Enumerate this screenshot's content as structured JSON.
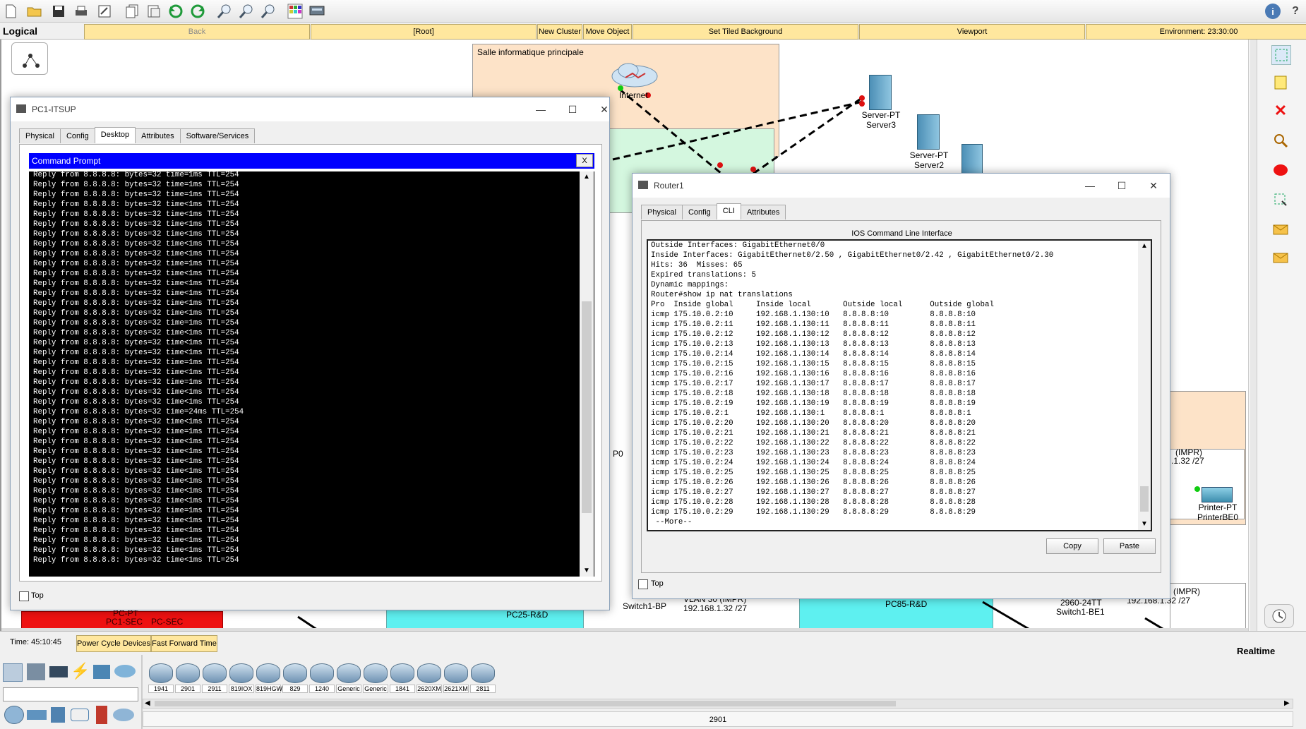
{
  "toolbar": {
    "icons": [
      "new-icon",
      "open-icon",
      "save-icon",
      "print-icon",
      "activity-wizard-icon",
      "copy-icon",
      "paste-icon",
      "undo-icon",
      "redo-icon",
      "zoom-in-icon",
      "zoom-reset-icon",
      "zoom-out-icon",
      "palette-icon",
      "custom-device-icon"
    ],
    "help_icon": "i"
  },
  "navbar": {
    "mode": "Logical",
    "back": "Back",
    "root": "[Root]",
    "new_cluster": "New Cluster",
    "move_object": "Move Object",
    "set_tiled_background": "Set Tiled Background",
    "viewport": "Viewport",
    "environment": "Environment: 23:30:00"
  },
  "workspace": {
    "cluster_label": "Salle informatique principale",
    "nodes": {
      "internet": "Internet",
      "server3_type": "Server-PT",
      "server3_name": "Server3",
      "server2_type": "Server-PT",
      "server2_name": "Server2",
      "printer_type": "Printer-PT",
      "printer_name": "PrinterBE0",
      "impr1": "(IMPR)",
      "impr1_ip": ".1.32 /27",
      "impr2": "(IMPR)",
      "impr2_ip": "192.168.1.32 /27",
      "vlan30": "VLAN 30 (IMPR)",
      "vlan30_ip": "192.168.1.32 /27",
      "pc85": "PC85-R&D",
      "pc25": "PC25-R&D",
      "switch_bp": "Switch1-BP",
      "switch_be_model": "2960-24TT",
      "switch_be": "Switch1-BE1",
      "pc_pt": "PC-PT",
      "pc1sec": "PC1-SEC",
      "pc2sec": "PC-SEC",
      "p0": "P0"
    }
  },
  "pc_window": {
    "title": "PC1-ITSUP",
    "tabs": [
      "Physical",
      "Config",
      "Desktop",
      "Attributes",
      "Software/Services"
    ],
    "active_tab": "Desktop",
    "cmd_title": "Command Prompt",
    "cmd_close": "X",
    "lines": [
      "Reply from 8.8.8.8: bytes=32 time=1ms TTL=254",
      "Reply from 8.8.8.8: bytes=32 time=1ms TTL=254",
      "Reply from 8.8.8.8: bytes=32 time=1ms TTL=254",
      "Reply from 8.8.8.8: bytes=32 time<1ms TTL=254",
      "Reply from 8.8.8.8: bytes=32 time<1ms TTL=254",
      "Reply from 8.8.8.8: bytes=32 time<1ms TTL=254",
      "Reply from 8.8.8.8: bytes=32 time<1ms TTL=254",
      "Reply from 8.8.8.8: bytes=32 time<1ms TTL=254",
      "Reply from 8.8.8.8: bytes=32 time<1ms TTL=254",
      "Reply from 8.8.8.8: bytes=32 time=1ms TTL=254",
      "Reply from 8.8.8.8: bytes=32 time<1ms TTL=254",
      "Reply from 8.8.8.8: bytes=32 time<1ms TTL=254",
      "Reply from 8.8.8.8: bytes=32 time<1ms TTL=254",
      "Reply from 8.8.8.8: bytes=32 time<1ms TTL=254",
      "Reply from 8.8.8.8: bytes=32 time<1ms TTL=254",
      "Reply from 8.8.8.8: bytes=32 time=1ms TTL=254",
      "Reply from 8.8.8.8: bytes=32 time<1ms TTL=254",
      "Reply from 8.8.8.8: bytes=32 time<1ms TTL=254",
      "Reply from 8.8.8.8: bytes=32 time<1ms TTL=254",
      "Reply from 8.8.8.8: bytes=32 time=1ms TTL=254",
      "Reply from 8.8.8.8: bytes=32 time<1ms TTL=254",
      "Reply from 8.8.8.8: bytes=32 time=1ms TTL=254",
      "Reply from 8.8.8.8: bytes=32 time<1ms TTL=254",
      "Reply from 8.8.8.8: bytes=32 time<1ms TTL=254",
      "Reply from 8.8.8.8: bytes=32 time=24ms TTL=254",
      "Reply from 8.8.8.8: bytes=32 time<1ms TTL=254",
      "Reply from 8.8.8.8: bytes=32 time=1ms TTL=254",
      "Reply from 8.8.8.8: bytes=32 time<1ms TTL=254",
      "Reply from 8.8.8.8: bytes=32 time<1ms TTL=254",
      "Reply from 8.8.8.8: bytes=32 time<1ms TTL=254",
      "Reply from 8.8.8.8: bytes=32 time<1ms TTL=254",
      "Reply from 8.8.8.8: bytes=32 time<1ms TTL=254",
      "Reply from 8.8.8.8: bytes=32 time<1ms TTL=254",
      "Reply from 8.8.8.8: bytes=32 time<1ms TTL=254",
      "Reply from 8.8.8.8: bytes=32 time=1ms TTL=254",
      "Reply from 8.8.8.8: bytes=32 time<1ms TTL=254",
      "Reply from 8.8.8.8: bytes=32 time<1ms TTL=254",
      "Reply from 8.8.8.8: bytes=32 time<1ms TTL=254",
      "Reply from 8.8.8.8: bytes=32 time<1ms TTL=254",
      "Reply from 8.8.8.8: bytes=32 time<1ms TTL=254"
    ],
    "top_label": "Top"
  },
  "router_window": {
    "title": "Router1",
    "tabs": [
      "Physical",
      "Config",
      "CLI",
      "Attributes"
    ],
    "active_tab": "CLI",
    "cli_heading": "IOS Command Line Interface",
    "lines": [
      "Outside Interfaces: GigabitEthernet0/0",
      "Inside Interfaces: GigabitEthernet0/2.50 , GigabitEthernet0/2.42 , GigabitEthernet0/2.30",
      "Hits: 36  Misses: 65",
      "Expired translations: 5",
      "Dynamic mappings:",
      "Router#show ip nat translations",
      "Pro  Inside global     Inside local       Outside local      Outside global",
      "icmp 175.10.0.2:10     192.168.1.130:10   8.8.8.8:10         8.8.8.8:10",
      "icmp 175.10.0.2:11     192.168.1.130:11   8.8.8.8:11         8.8.8.8:11",
      "icmp 175.10.0.2:12     192.168.1.130:12   8.8.8.8:12         8.8.8.8:12",
      "icmp 175.10.0.2:13     192.168.1.130:13   8.8.8.8:13         8.8.8.8:13",
      "icmp 175.10.0.2:14     192.168.1.130:14   8.8.8.8:14         8.8.8.8:14",
      "icmp 175.10.0.2:15     192.168.1.130:15   8.8.8.8:15         8.8.8.8:15",
      "icmp 175.10.0.2:16     192.168.1.130:16   8.8.8.8:16         8.8.8.8:16",
      "icmp 175.10.0.2:17     192.168.1.130:17   8.8.8.8:17         8.8.8.8:17",
      "icmp 175.10.0.2:18     192.168.1.130:18   8.8.8.8:18         8.8.8.8:18",
      "icmp 175.10.0.2:19     192.168.1.130:19   8.8.8.8:19         8.8.8.8:19",
      "icmp 175.10.0.2:1      192.168.1.130:1    8.8.8.8:1          8.8.8.8:1",
      "icmp 175.10.0.2:20     192.168.1.130:20   8.8.8.8:20         8.8.8.8:20",
      "icmp 175.10.0.2:21     192.168.1.130:21   8.8.8.8:21         8.8.8.8:21",
      "icmp 175.10.0.2:22     192.168.1.130:22   8.8.8.8:22         8.8.8.8:22",
      "icmp 175.10.0.2:23     192.168.1.130:23   8.8.8.8:23         8.8.8.8:23",
      "icmp 175.10.0.2:24     192.168.1.130:24   8.8.8.8:24         8.8.8.8:24",
      "icmp 175.10.0.2:25     192.168.1.130:25   8.8.8.8:25         8.8.8.8:25",
      "icmp 175.10.0.2:26     192.168.1.130:26   8.8.8.8:26         8.8.8.8:26",
      "icmp 175.10.0.2:27     192.168.1.130:27   8.8.8.8:27         8.8.8.8:27",
      "icmp 175.10.0.2:28     192.168.1.130:28   8.8.8.8:28         8.8.8.8:28",
      "icmp 175.10.0.2:29     192.168.1.130:29   8.8.8.8:29         8.8.8.8:29",
      " --More-- "
    ],
    "copy": "Copy",
    "paste": "Paste",
    "top_label": "Top"
  },
  "statusbar": {
    "time": "Time: 45:10:45",
    "power_cycle": "Power Cycle Devices",
    "fast_forward": "Fast Forward Time",
    "realtime": "Realtime"
  },
  "devicebar": {
    "models": [
      "1941",
      "2901",
      "2911",
      "819IOX",
      "819HGW",
      "829",
      "1240",
      "Generic",
      "Generic",
      "1841",
      "2620XM",
      "2621XM",
      "2811"
    ],
    "selected_model": "2901"
  }
}
